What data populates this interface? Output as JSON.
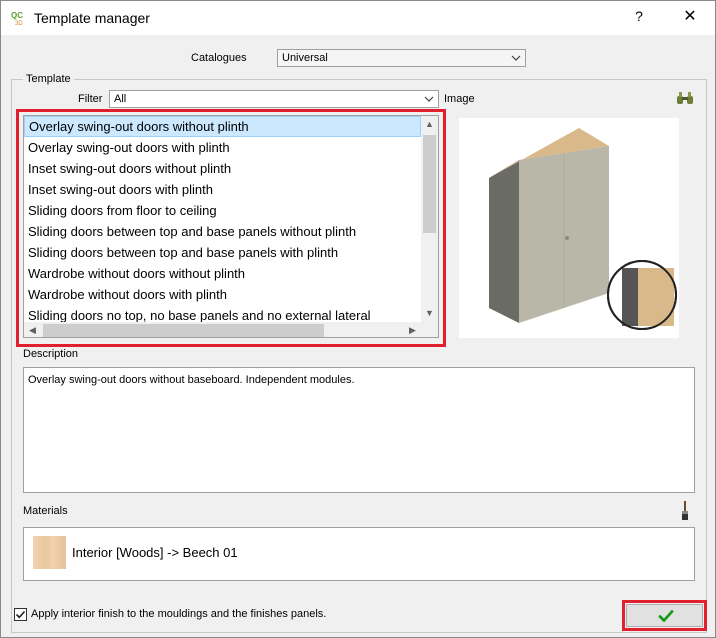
{
  "window": {
    "title": "Template manager",
    "help_label": "?",
    "close_label": "✕"
  },
  "catalogues": {
    "label": "Catalogues",
    "value": "Universal"
  },
  "template": {
    "group_label": "Template",
    "filter_label": "Filter",
    "filter_value": "All",
    "image_label": "Image",
    "items": [
      "Overlay swing-out doors without plinth",
      "Overlay swing-out doors with plinth",
      "Inset swing-out doors without plinth",
      "Inset swing-out doors with plinth",
      "Sliding doors from floor to ceiling",
      "Sliding doors between top and base panels without plinth",
      "Sliding doors between top and base panels with plinth",
      "Wardrobe without doors without plinth",
      "Wardrobe without doors with plinth",
      "Sliding doors no top, no base panels and no external lateral"
    ],
    "selected_index": 0
  },
  "description": {
    "label": "Description",
    "text": "Overlay swing-out doors without baseboard. Independent modules."
  },
  "materials": {
    "label": "Materials",
    "item": "Interior [Woods] -> Beech 01"
  },
  "apply_checkbox": {
    "label": "Apply interior finish to the mouldings and the finishes panels.",
    "checked": true
  },
  "icons": {
    "app": "app-logo-icon",
    "binoculars": "binoculars-icon",
    "brush": "brush-icon",
    "ok": "checkmark-icon"
  },
  "colors": {
    "highlight": "#e0202e",
    "ok_check": "#1a9a1a",
    "selection": "#cce8ff"
  }
}
